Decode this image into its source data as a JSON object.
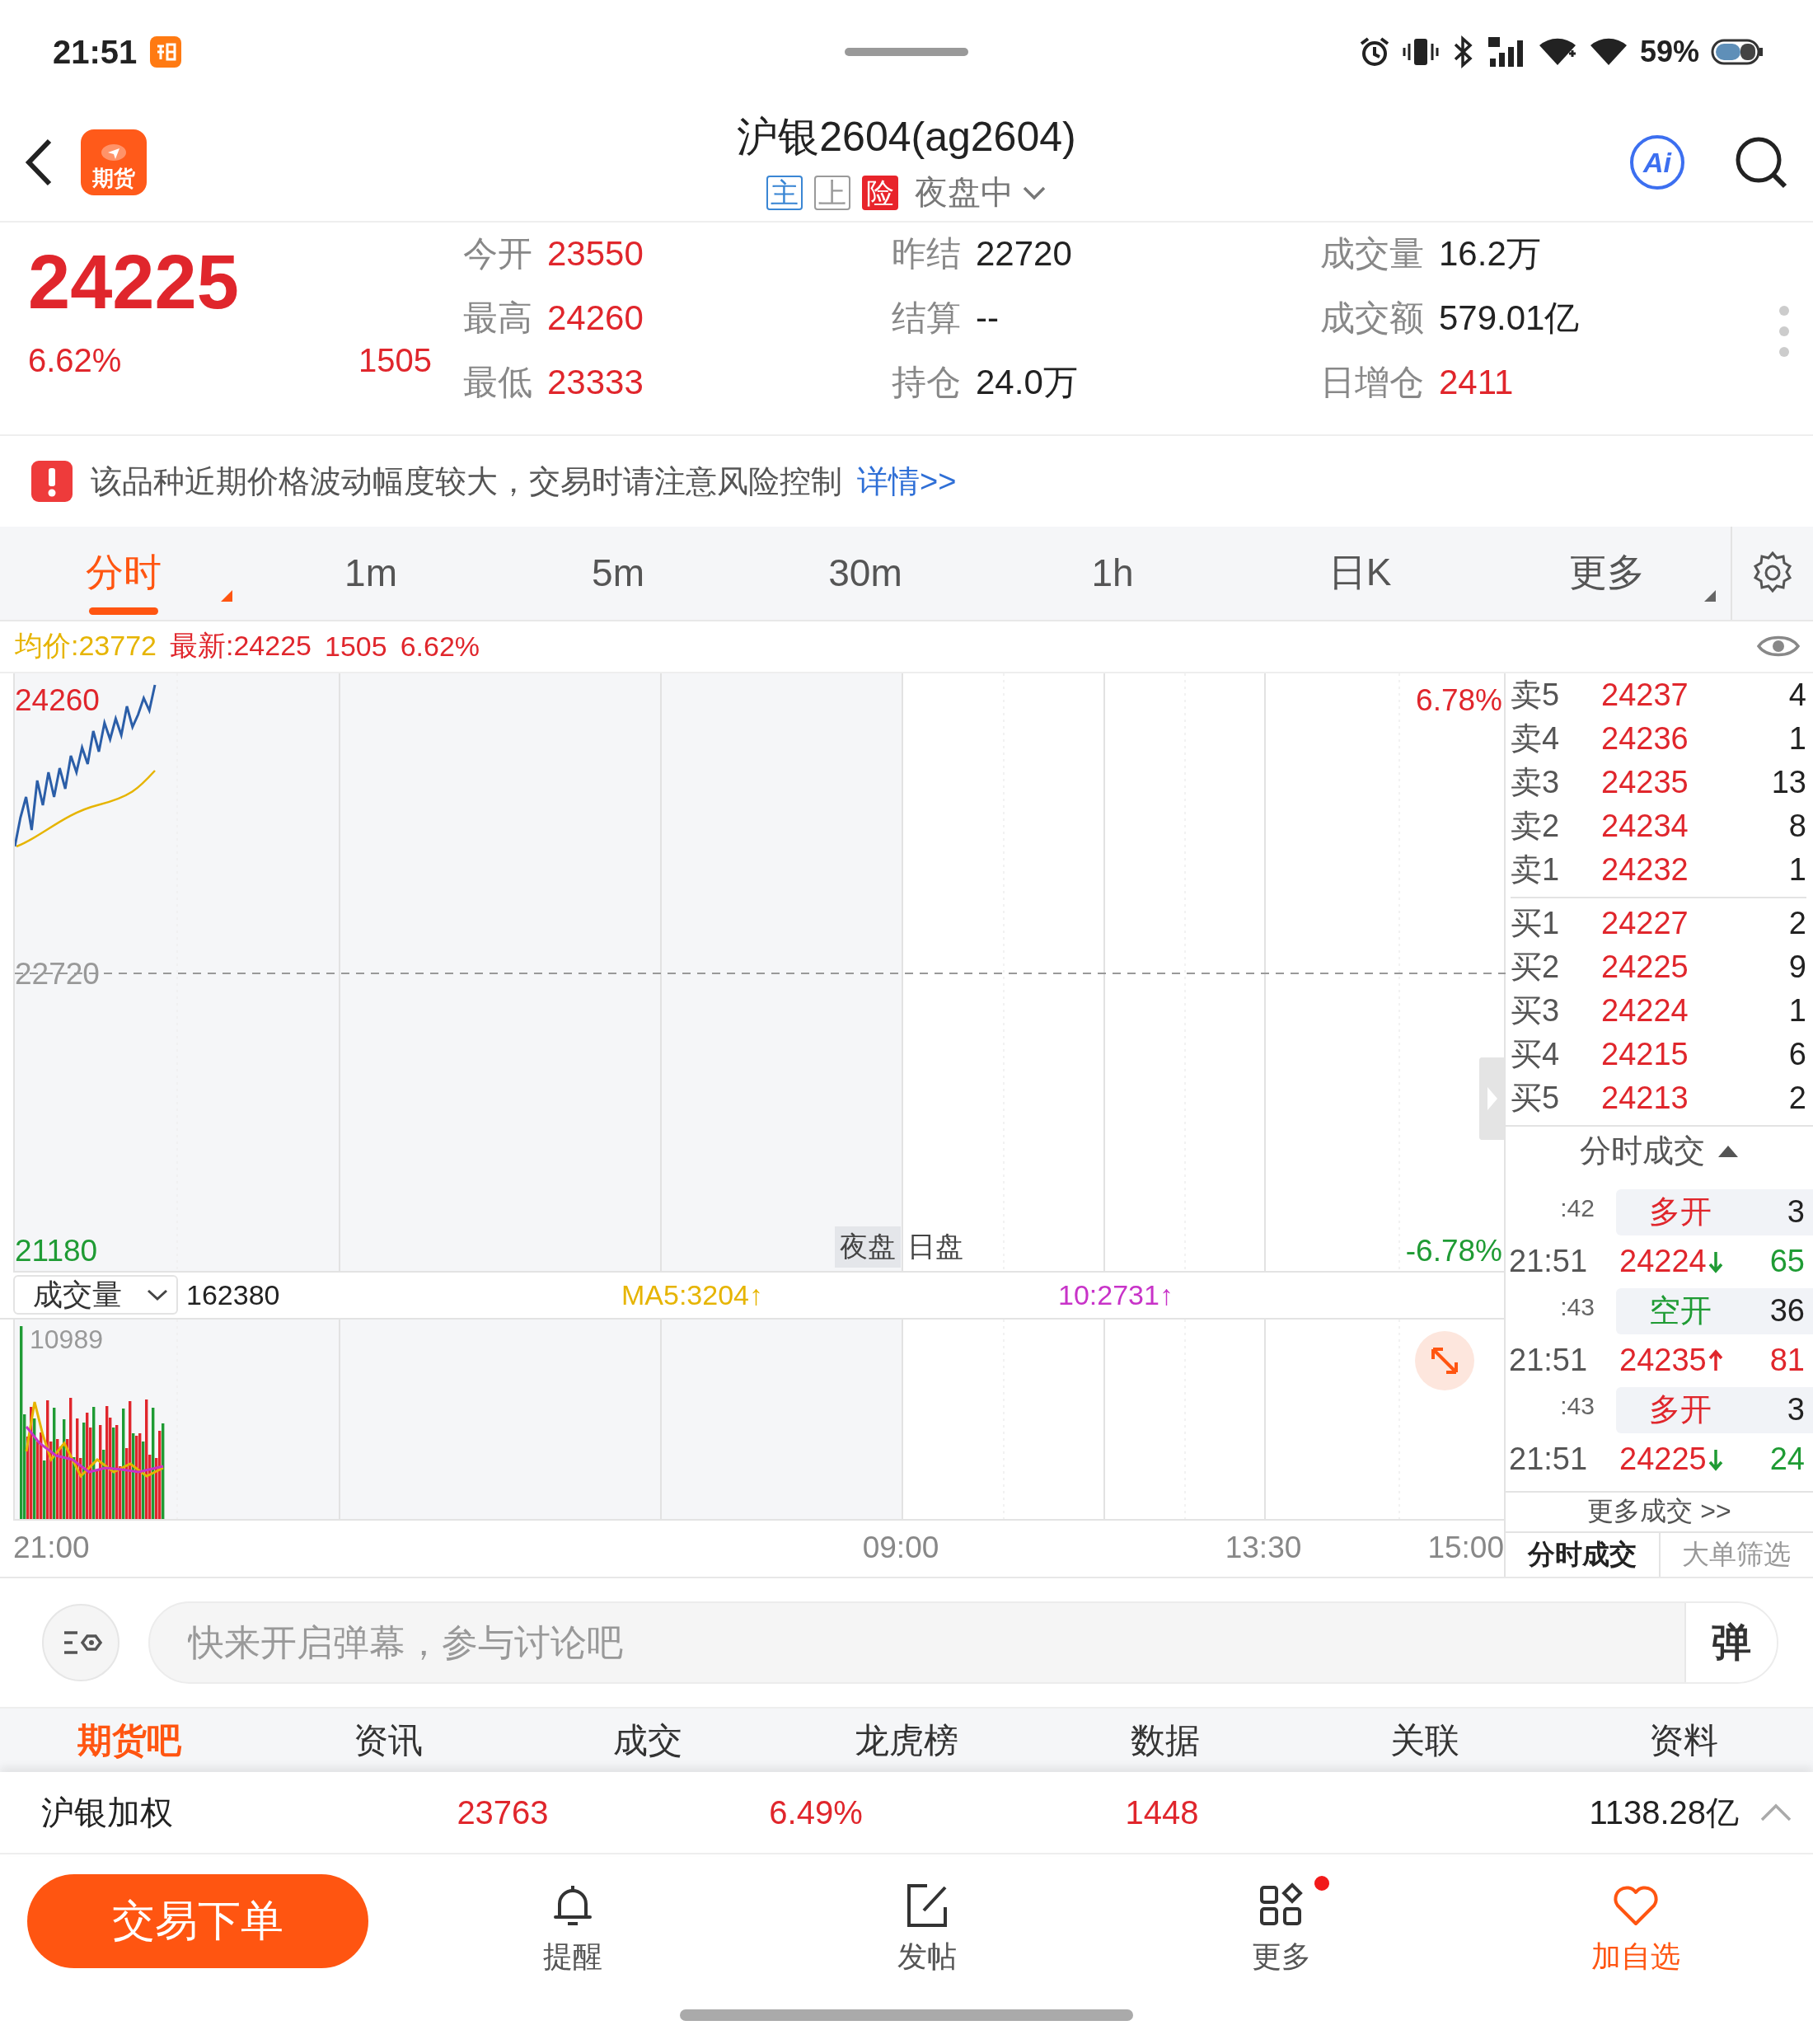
{
  "status_bar": {
    "time": "21:51",
    "battery_text": "59%"
  },
  "header": {
    "logo_text": "期货",
    "title": "沪银2604(ag2604)",
    "badges": [
      {
        "text": "主",
        "kind": "outline",
        "color": "#3a86d4"
      },
      {
        "text": "上",
        "kind": "outline",
        "color": "#9a9a9a"
      },
      {
        "text": "险",
        "kind": "filled",
        "color": "#e8242b"
      }
    ],
    "session": "夜盘中",
    "ai_label": "Ai"
  },
  "quote": {
    "price": "24225",
    "change_pct": "6.62%",
    "change": "1505",
    "stats": [
      [
        {
          "label": "今开",
          "value": "23550",
          "color": "#e0262c"
        },
        {
          "label": "昨结",
          "value": "22720",
          "color": "#222222"
        },
        {
          "label": "成交量",
          "value": "16.2万",
          "color": "#222222"
        }
      ],
      [
        {
          "label": "最高",
          "value": "24260",
          "color": "#e0262c"
        },
        {
          "label": "结算",
          "value": "--",
          "color": "#222222"
        },
        {
          "label": "成交额",
          "value": "579.01亿",
          "color": "#222222"
        }
      ],
      [
        {
          "label": "最低",
          "value": "23333",
          "color": "#e0262c"
        },
        {
          "label": "持仓",
          "value": "24.0万",
          "color": "#222222"
        },
        {
          "label": "日增仓",
          "value": "2411",
          "color": "#e0262c"
        }
      ]
    ]
  },
  "warning": {
    "text": "该品种近期价格波动幅度较大，交易时请注意风险控制",
    "link": "详情>>"
  },
  "period_tabs": [
    {
      "label": "分时",
      "selected": true,
      "menu": true
    },
    {
      "label": "1m",
      "selected": false,
      "menu": false
    },
    {
      "label": "5m",
      "selected": false,
      "menu": false
    },
    {
      "label": "30m",
      "selected": false,
      "menu": false
    },
    {
      "label": "1h",
      "selected": false,
      "menu": false
    },
    {
      "label": "日K",
      "selected": false,
      "menu": false
    },
    {
      "label": "更多",
      "selected": false,
      "menu": true
    }
  ],
  "chart": {
    "avg_price": "均价:23772",
    "latest": "最新:24225",
    "change": "1505",
    "change_pct": "6.62%",
    "high_label": "24260",
    "mid_label": "22720",
    "low_label": "21180",
    "high_pct": "6.78%",
    "low_pct": "-6.78%",
    "session_labels": [
      "夜盘",
      "日盘"
    ],
    "volume_selector": "成交量",
    "volume_total": "162380",
    "ma5": "MA5:3204↑",
    "ma10": "10:2731↑",
    "volume_max": "10989",
    "time_ticks": [
      "21:00",
      "09:00",
      "13:30",
      "15:00"
    ]
  },
  "order_book": {
    "asks": [
      {
        "label": "卖5",
        "price": "24237",
        "volume": "4"
      },
      {
        "label": "卖4",
        "price": "24236",
        "volume": "1"
      },
      {
        "label": "卖3",
        "price": "24235",
        "volume": "13"
      },
      {
        "label": "卖2",
        "price": "24234",
        "volume": "8"
      },
      {
        "label": "卖1",
        "price": "24232",
        "volume": "1"
      }
    ],
    "bids": [
      {
        "label": "买1",
        "price": "24227",
        "volume": "2"
      },
      {
        "label": "买2",
        "price": "24225",
        "volume": "9"
      },
      {
        "label": "买3",
        "price": "24224",
        "volume": "1"
      },
      {
        "label": "买4",
        "price": "24215",
        "volume": "6"
      },
      {
        "label": "买5",
        "price": "24213",
        "volume": "2"
      }
    ]
  },
  "trades": {
    "title": "分时成交",
    "rows": [
      {
        "seconds": ":42",
        "action": "多开",
        "color": "#e0262c",
        "action_volume": "3",
        "time": "21:51",
        "price": "24224",
        "kind": "down",
        "volume": "65"
      },
      {
        "seconds": ":43",
        "action": "空开",
        "color": "#1f9b34",
        "action_volume": "36",
        "time": "21:51",
        "price": "24235",
        "kind": "up",
        "volume": "81"
      },
      {
        "seconds": ":43",
        "action": "多开",
        "color": "#e0262c",
        "action_volume": "3",
        "time": "21:51",
        "price": "24225",
        "kind": "down",
        "volume": "24"
      }
    ],
    "more": "更多成交 >>",
    "tabs": [
      {
        "label": "分时成交",
        "selected": true
      },
      {
        "label": "大单筛选",
        "selected": false
      }
    ]
  },
  "comment": {
    "placeholder": "快来开启弹幕，参与讨论吧",
    "danmaku_button": "弹"
  },
  "section_tabs": [
    {
      "label": "期货吧",
      "selected": true
    },
    {
      "label": "资讯",
      "selected": false
    },
    {
      "label": "成交",
      "selected": false
    },
    {
      "label": "龙虎榜",
      "selected": false
    },
    {
      "label": "数据",
      "selected": false
    },
    {
      "label": "关联",
      "selected": false
    },
    {
      "label": "资料",
      "selected": false
    }
  ],
  "weighted": {
    "name": "沪银加权",
    "price": "23763",
    "change_pct": "6.49%",
    "change": "1448",
    "turnover": "1138.28亿"
  },
  "bottom_nav": {
    "order_button": "交易下单",
    "items": [
      {
        "label": "提醒",
        "kind": "bell",
        "accent": false,
        "dot": false
      },
      {
        "label": "发帖",
        "kind": "compose",
        "accent": false,
        "dot": false
      },
      {
        "label": "更多",
        "kind": "grid",
        "accent": false,
        "dot": true
      },
      {
        "label": "加自选",
        "kind": "heart",
        "accent": true,
        "dot": false
      }
    ]
  }
}
